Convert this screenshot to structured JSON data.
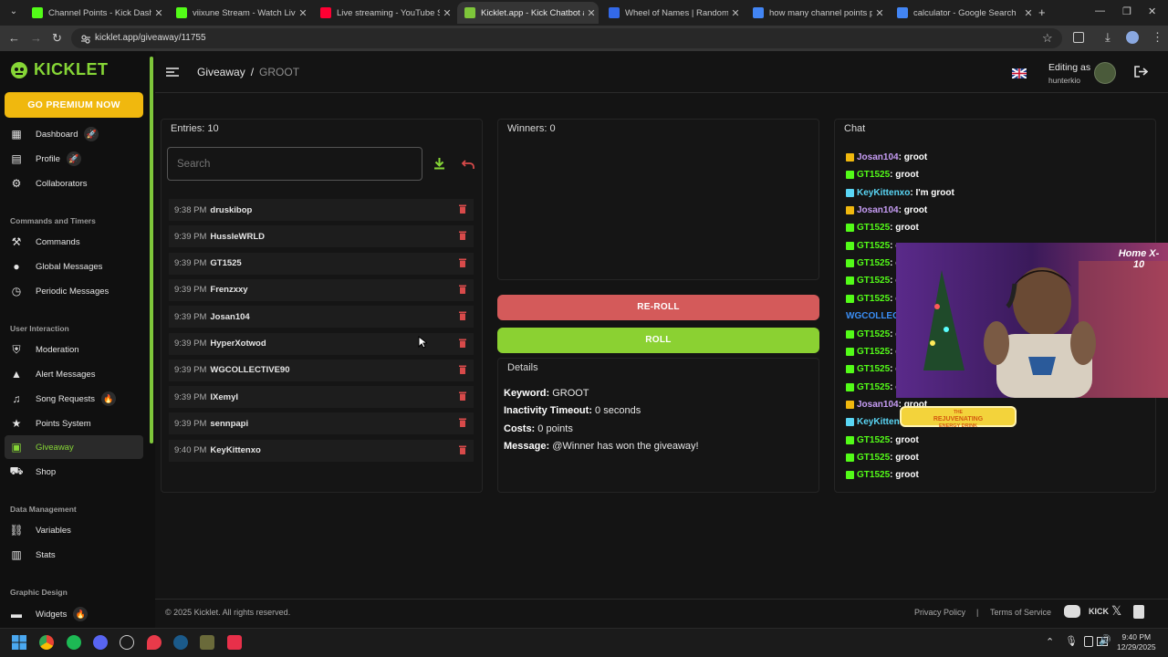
{
  "browser": {
    "tabs": [
      {
        "title": "Channel Points - Kick Dashboard",
        "color": "#53fc18"
      },
      {
        "title": "viixune Stream - Watch Live on Kick",
        "color": "#53fc18"
      },
      {
        "title": "Live streaming - YouTube Studio",
        "color": "#ff0033"
      },
      {
        "title": "Kicklet.app - Kick Chatbot and Tools",
        "color": "#7ec63a"
      },
      {
        "title": "Wheel of Names | Random name picker",
        "color": "#3369e8"
      },
      {
        "title": "how many channel points per hour",
        "color": "#4285f4"
      },
      {
        "title": "calculator - Google Search",
        "color": "#4285f4"
      }
    ],
    "new_tab": "+",
    "url": "kicklet.app/giveaway/11755"
  },
  "sidebar": {
    "logo": "KICKLET",
    "premium": "GO PREMIUM NOW",
    "items": [
      {
        "label": "Dashboard",
        "icon": "dashboard-icon",
        "badge": "🚀"
      },
      {
        "label": "Profile",
        "icon": "profile-icon",
        "badge": "🚀"
      },
      {
        "label": "Collaborators",
        "icon": "collaborators-icon"
      },
      {
        "label": "Commands",
        "icon": "commands-icon"
      },
      {
        "label": "Global Messages",
        "icon": "global-messages-icon"
      },
      {
        "label": "Periodic Messages",
        "icon": "periodic-messages-icon"
      },
      {
        "label": "Moderation",
        "icon": "shield-icon"
      },
      {
        "label": "Alert Messages",
        "icon": "alert-icon"
      },
      {
        "label": "Song Requests",
        "icon": "music-icon",
        "badge": "🔥"
      },
      {
        "label": "Points System",
        "icon": "star-icon"
      },
      {
        "label": "Giveaway",
        "icon": "gift-icon"
      },
      {
        "label": "Shop",
        "icon": "cart-icon"
      },
      {
        "label": "Variables",
        "icon": "link-icon"
      },
      {
        "label": "Stats",
        "icon": "stats-icon"
      },
      {
        "label": "Widgets",
        "icon": "widgets-icon",
        "badge": "🔥"
      }
    ],
    "sections": [
      "Commands and Timers",
      "User Interaction",
      "Data Management",
      "Graphic Design"
    ]
  },
  "header": {
    "crumb_root": "Giveaway",
    "crumb_sep": "/",
    "crumb_current": "GROOT",
    "editing_label": "Editing as",
    "editing_user": "hunterkio"
  },
  "entries": {
    "title": "Entries: 10",
    "search_placeholder": "Search",
    "rows": [
      {
        "time": "9:38 PM",
        "name": "druskibop"
      },
      {
        "time": "9:39 PM",
        "name": "HussleWRLD"
      },
      {
        "time": "9:39 PM",
        "name": "GT1525"
      },
      {
        "time": "9:39 PM",
        "name": "Frenzxxy"
      },
      {
        "time": "9:39 PM",
        "name": "Josan104"
      },
      {
        "time": "9:39 PM",
        "name": "HyperXotwod"
      },
      {
        "time": "9:39 PM",
        "name": "WGCOLLECTIVE90"
      },
      {
        "time": "9:39 PM",
        "name": "IXemyI"
      },
      {
        "time": "9:39 PM",
        "name": "sennpapi"
      },
      {
        "time": "9:40 PM",
        "name": "KeyKittenxo"
      }
    ]
  },
  "winners": {
    "title": "Winners: 0",
    "reroll": "RE-ROLL",
    "roll": "ROLL",
    "reroll_color": "#d45a5a",
    "roll_color": "#8bd132"
  },
  "details": {
    "title": "Details",
    "keyword_label": "Keyword:",
    "keyword_value": "GROOT",
    "timeout_label": "Inactivity Timeout:",
    "timeout_value": "0 seconds",
    "costs_label": "Costs:",
    "costs_value": "0 points",
    "message_label": "Message:",
    "message_value": "@Winner has won the giveaway!"
  },
  "chat": {
    "title": "Chat",
    "lines": [
      {
        "user": "Josan104",
        "msg": "groot",
        "color": "#c79df5",
        "badge": "#f0b80e"
      },
      {
        "user": "GT1525",
        "msg": "groot",
        "color": "#53fc18",
        "badge": "#53fc18"
      },
      {
        "user": "KeyKittenxo",
        "msg": "I'm groot",
        "color": "#5ad6f5",
        "badge": "#5ad6f5"
      },
      {
        "user": "Josan104",
        "msg": "groot",
        "color": "#c79df5",
        "badge": "#f0b80e"
      },
      {
        "user": "GT1525",
        "msg": "groot",
        "color": "#53fc18",
        "badge": "#53fc18"
      },
      {
        "user": "GT1525",
        "msg": "g",
        "color": "#53fc18",
        "badge": "#53fc18"
      },
      {
        "user": "GT1525",
        "msg": "g",
        "color": "#53fc18",
        "badge": "#53fc18"
      },
      {
        "user": "GT1525",
        "msg": "g",
        "color": "#53fc18",
        "badge": "#53fc18"
      },
      {
        "user": "GT1525",
        "msg": "g",
        "color": "#53fc18",
        "badge": "#53fc18"
      },
      {
        "user": "WGCOLLEC",
        "msg": "",
        "color": "#3a8ef5",
        "badge": ""
      },
      {
        "user": "GT1525",
        "msg": "g",
        "color": "#53fc18",
        "badge": "#53fc18"
      },
      {
        "user": "GT1525",
        "msg": "g",
        "color": "#53fc18",
        "badge": "#53fc18"
      },
      {
        "user": "GT1525",
        "msg": "g",
        "color": "#53fc18",
        "badge": "#53fc18"
      },
      {
        "user": "GT1525",
        "msg": "g",
        "color": "#53fc18",
        "badge": "#53fc18"
      },
      {
        "user": "Josan104",
        "msg": "groot",
        "color": "#c79df5",
        "badge": "#f0b80e"
      },
      {
        "user": "KeyKitten",
        "msg": "",
        "color": "#5ad6f5",
        "badge": "#5ad6f5"
      },
      {
        "user": "GT1525",
        "msg": "groot",
        "color": "#53fc18",
        "badge": "#53fc18"
      },
      {
        "user": "GT1525",
        "msg": "groot",
        "color": "#53fc18",
        "badge": "#53fc18"
      },
      {
        "user": "GT1525",
        "msg": "groot",
        "color": "#53fc18",
        "badge": "#53fc18"
      }
    ]
  },
  "overlay": {
    "webcam_logo": "Home X-10",
    "banner_line1": "THE",
    "banner_line2": "REJUVENATING",
    "banner_line3": "ENERGY DRINK"
  },
  "footer": {
    "copyright": "© 2025 Kicklet. All rights reserved.",
    "privacy": "Privacy Policy",
    "sep": "|",
    "terms": "Terms of Service",
    "kick": "KICK"
  },
  "taskbar": {
    "time": "9:40 PM",
    "date": "12/29/2025"
  }
}
